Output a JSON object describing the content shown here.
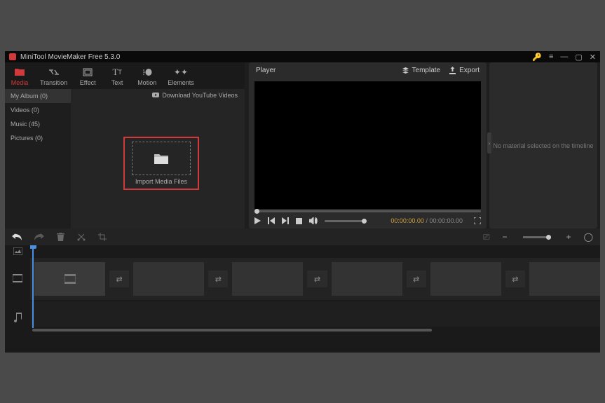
{
  "window": {
    "title": "MiniTool MovieMaker Free 5.3.0"
  },
  "toolbar": {
    "media": "Media",
    "transition": "Transition",
    "effect": "Effect",
    "text": "Text",
    "motion": "Motion",
    "elements": "Elements"
  },
  "albums": {
    "my_album": "My Album (0)",
    "videos": "Videos (0)",
    "music": "Music (45)",
    "pictures": "Pictures (0)"
  },
  "media_area": {
    "download_yt": "Download YouTube Videos",
    "import_label": "Import Media Files"
  },
  "player": {
    "title": "Player",
    "template": "Template",
    "export": "Export",
    "time_current": "00:00:00.00",
    "time_separator": " / ",
    "time_total": "00:00:00.00"
  },
  "inspector": {
    "empty_text": "No material selected on the timeline"
  }
}
